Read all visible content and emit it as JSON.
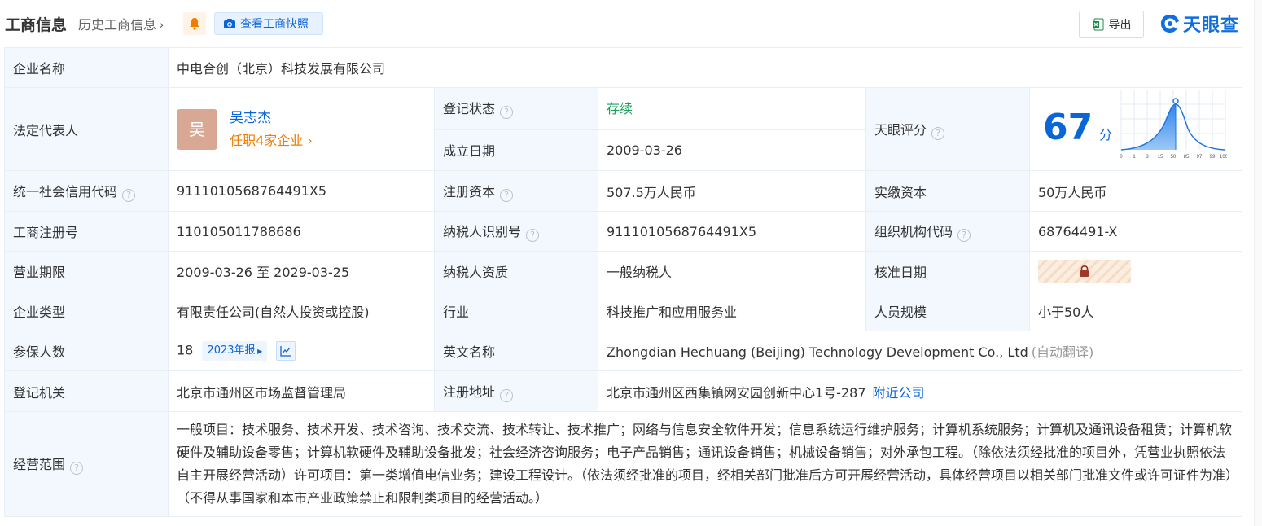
{
  "header": {
    "title": "工商信息",
    "history_link": "历史工商信息",
    "snapshot_button": "查看工商快照",
    "export_button": "导出",
    "logo_text": "天眼查"
  },
  "rows": {
    "company_name_label": "企业名称",
    "company_name": "中电合创（北京）科技发展有限公司",
    "legal_rep_label": "法定代表人",
    "legal_rep_avatar": "吴",
    "legal_rep_name": "吴志杰",
    "legal_rep_jobs": "任职4家企业",
    "reg_status_label": "登记状态",
    "reg_status": "存续",
    "found_date_label": "成立日期",
    "found_date": "2009-03-26",
    "score_label": "天眼评分",
    "score": "67",
    "score_unit": "分",
    "score_axis": [
      "0",
      "1",
      "3",
      "15",
      "50",
      "85",
      "97",
      "99",
      "100"
    ],
    "credit_code_label": "统一社会信用代码",
    "credit_code": "9111010568764491X5",
    "reg_capital_label": "注册资本",
    "reg_capital": "507.5万人民币",
    "paid_capital_label": "实缴资本",
    "paid_capital": "50万人民币",
    "biz_reg_no_label": "工商注册号",
    "biz_reg_no": "110105011788686",
    "taxpayer_id_label": "纳税人识别号",
    "taxpayer_id": "9111010568764491X5",
    "org_code_label": "组织机构代码",
    "org_code": "68764491-X",
    "biz_term_label": "营业期限",
    "biz_term": "2009-03-26 至 2029-03-25",
    "taxpayer_qual_label": "纳税人资质",
    "taxpayer_qual": "一般纳税人",
    "approval_date_label": "核准日期",
    "company_type_label": "企业类型",
    "company_type": "有限责任公司(自然人投资或控股)",
    "industry_label": "行业",
    "industry": "科技推广和应用服务业",
    "staff_size_label": "人员规模",
    "staff_size": "小于50人",
    "insured_label": "参保人数",
    "insured": "18",
    "insured_year": "2023年报",
    "english_name_label": "英文名称",
    "english_name": "Zhongdian Hechuang (Beijing) Technology Development Co., Ltd",
    "auto_translate": "(自动翻译)",
    "reg_authority_label": "登记机关",
    "reg_authority": "北京市通州区市场监督管理局",
    "reg_address_label": "注册地址",
    "reg_address": "北京市通州区西集镇网安园创新中心1号-287",
    "nearby_link": "附近公司",
    "biz_scope_label": "经营范围",
    "biz_scope": "一般项目：技术服务、技术开发、技术咨询、技术交流、技术转让、技术推广；网络与信息安全软件开发；信息系统运行维护服务；计算机系统服务；计算机及通讯设备租赁；计算机软硬件及辅助设备零售；计算机软硬件及辅助设备批发；社会经济咨询服务；电子产品销售；通讯设备销售；机械设备销售；对外承包工程。（除依法须经批准的项目外，凭营业执照依法自主开展经营活动）许可项目：第一类增值电信业务；建设工程设计。（依法须经批准的项目，经相关部门批准后方可开展经营活动，具体经营项目以相关部门批准文件或许可证件为准）（不得从事国家和本市产业政策禁止和限制类项目的经营活动。）"
  },
  "colors": {
    "accent_blue": "#0a66d6",
    "status_green": "#1ca15b",
    "orange": "#f07c00",
    "label_bg": "#f3f8fe"
  }
}
